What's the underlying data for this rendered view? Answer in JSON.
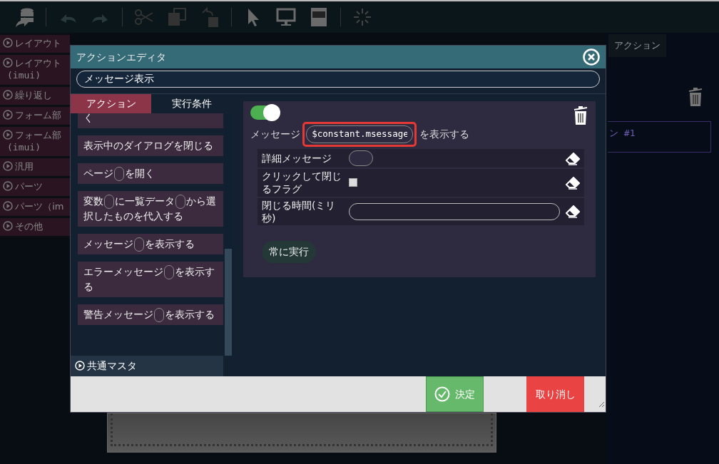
{
  "sidebar": {
    "items": [
      {
        "label": "レイアウト"
      },
      {
        "label": "レイアウト",
        "sub": "(imui)"
      },
      {
        "label": "繰り返し"
      },
      {
        "label": "フォーム部"
      },
      {
        "label": "フォーム部",
        "sub": "(imui)"
      },
      {
        "label": "汎用"
      },
      {
        "label": "パーツ"
      },
      {
        "label": "パーツ（im"
      },
      {
        "label": "その他"
      }
    ]
  },
  "right_panel": {
    "tab": "アクション",
    "action_label": "ン #1"
  },
  "dialog": {
    "title": "アクションエディタ",
    "name": {
      "value": "メッセージ表示"
    },
    "tabs": [
      {
        "label": "アクション",
        "selected": true
      },
      {
        "label": "実行条件",
        "selected": false
      }
    ],
    "actions": [
      {
        "parts": [
          "く"
        ]
      },
      {
        "parts": [
          "表示中のダイアログを閉じる"
        ]
      },
      {
        "parts": [
          "ページ",
          "を開く"
        ]
      },
      {
        "parts": [
          "変数",
          "に一覧データ",
          "から選択したものを代入する"
        ]
      },
      {
        "parts": [
          "メッセージ",
          "を表示する"
        ]
      },
      {
        "parts": [
          "エラーメッセージ",
          "を表示する"
        ]
      },
      {
        "parts": [
          "警告メッセージ",
          "を表示する"
        ]
      }
    ],
    "group": "共通マスタ",
    "editor": {
      "enabled": true,
      "prefix": "メッセージ",
      "value": "$constant.msessage",
      "highlighted": true,
      "suffix": "を表示する",
      "fields": [
        {
          "label": "詳細メッセージ",
          "kind": "pill"
        },
        {
          "label": "クリックして閉じるフラグ",
          "kind": "checkbox",
          "checked": false
        },
        {
          "label": "閉じる時間(ミリ秒)",
          "kind": "input"
        }
      ],
      "run_button": "常に実行"
    },
    "ok": "決定",
    "cancel": "取り消し"
  }
}
